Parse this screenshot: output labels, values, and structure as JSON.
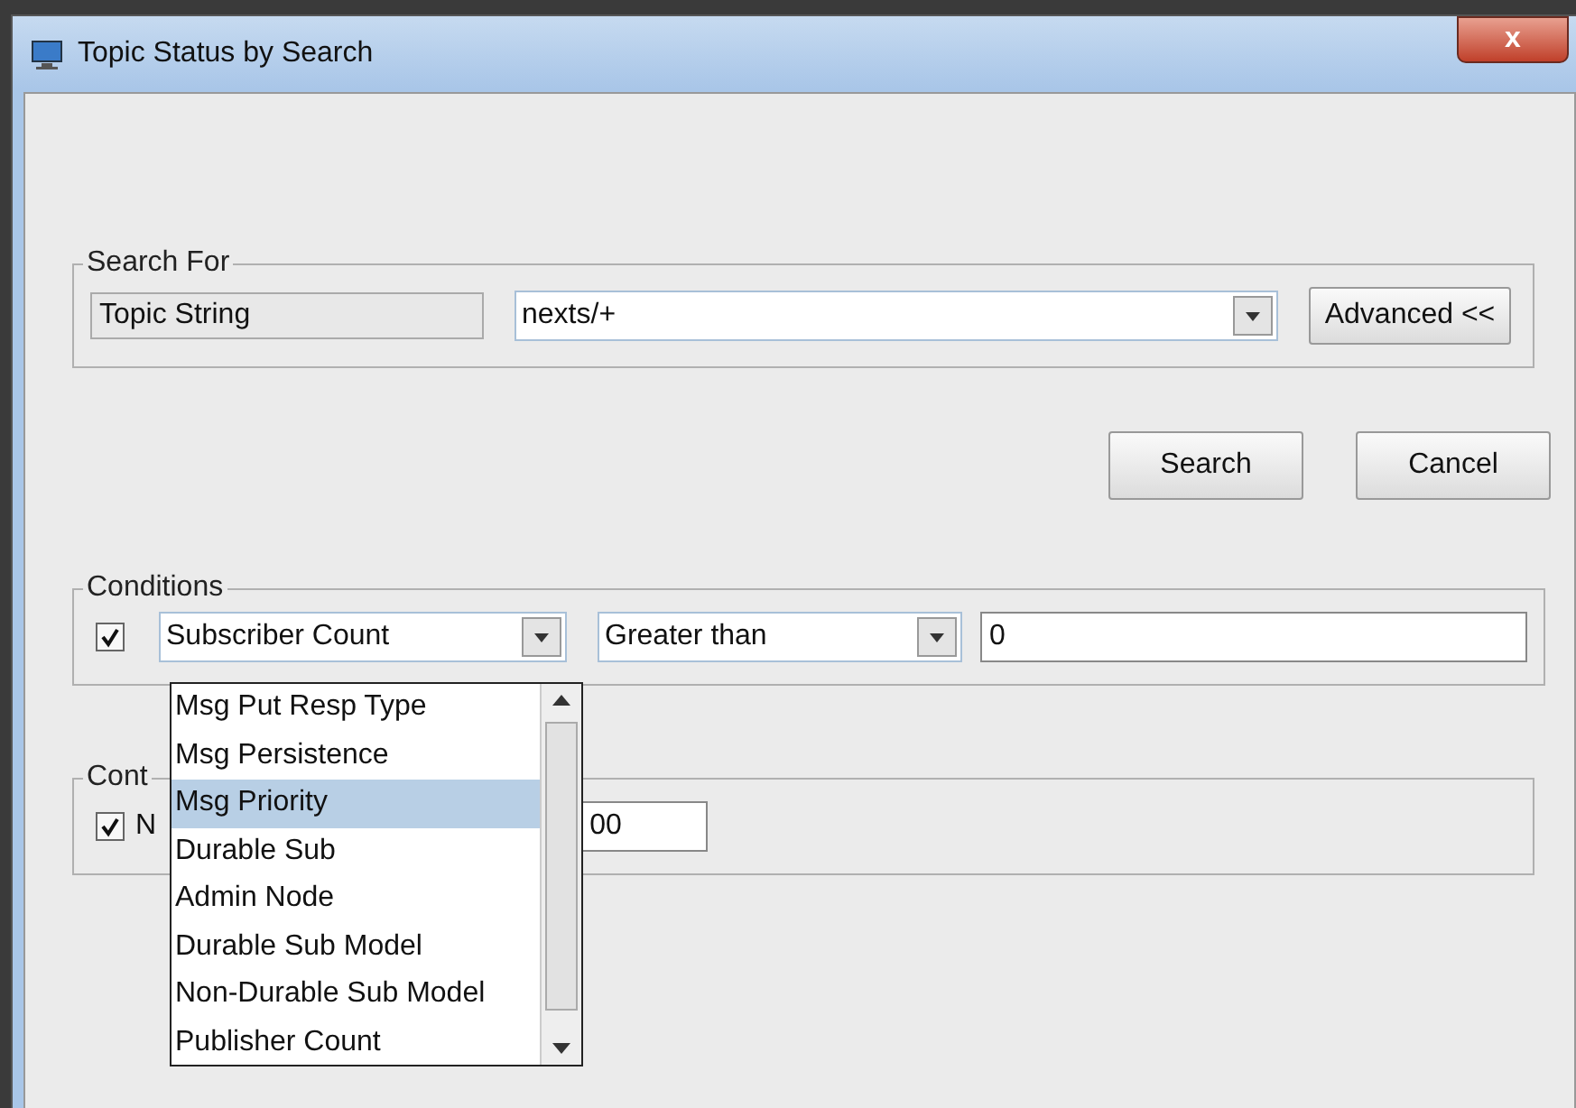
{
  "window": {
    "title": "Topic Status by Search",
    "close_label": "x"
  },
  "search_for": {
    "legend": "Search For",
    "label": "Topic String",
    "value": "nexts/+",
    "advanced_button": "Advanced <<"
  },
  "buttons": [
    "Search",
    "Cancel"
  ],
  "conditions": {
    "legend": "Conditions",
    "checked": true,
    "attribute": "Subscriber Count",
    "operator": "Greater than",
    "value": "0"
  },
  "second_group": {
    "legend": "Cont",
    "checked": true,
    "label": "N",
    "value": "00"
  },
  "dropdown": {
    "items": [
      {
        "label": "Msg Put Resp Type",
        "selected": false
      },
      {
        "label": "Msg Persistence",
        "selected": false
      },
      {
        "label": "Msg Priority",
        "selected": true
      },
      {
        "label": "Durable Sub",
        "selected": false
      },
      {
        "label": "Admin Node",
        "selected": false
      },
      {
        "label": "Durable Sub Model",
        "selected": false
      },
      {
        "label": "Non-Durable Sub Model",
        "selected": false
      },
      {
        "label": "Publisher Count",
        "selected": false
      }
    ]
  }
}
